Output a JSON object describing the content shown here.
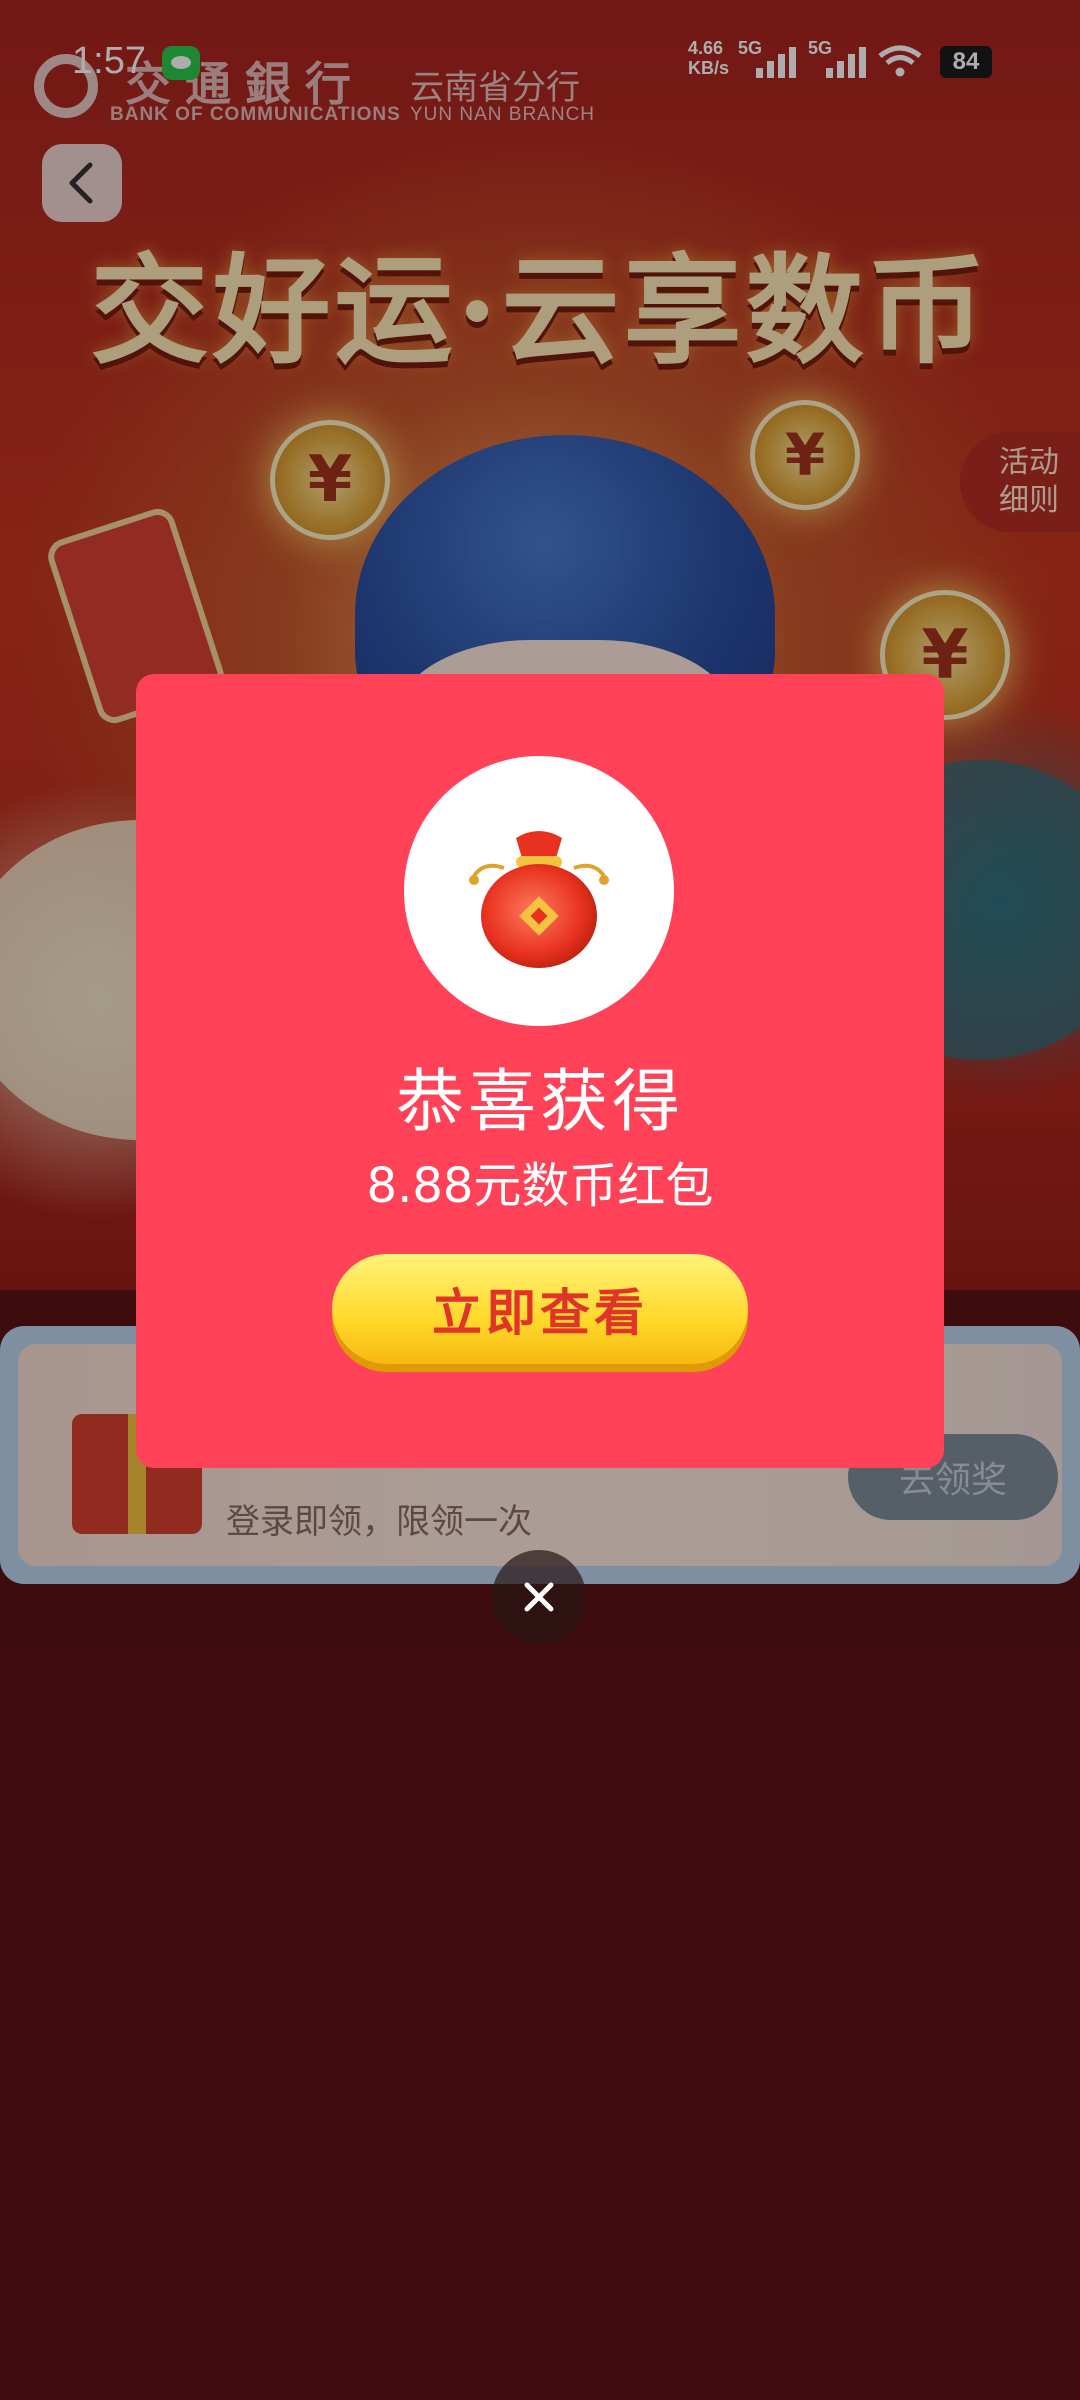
{
  "status_bar": {
    "time": "1:57",
    "net_speed_value": "4.66",
    "net_speed_unit": "KB/s",
    "network_type_1": "5G",
    "network_type_2": "5G",
    "battery": "84"
  },
  "header": {
    "bank_name_cn": "交通銀行",
    "bank_name_en": "BANK OF COMMUNICATIONS",
    "branch_cn": "云南省分行",
    "branch_en": "YUN NAN BRANCH"
  },
  "banner": {
    "title": "交好运·云享数币",
    "coin_symbol": "¥"
  },
  "rules_tab": {
    "line1": "活动",
    "line2": "细则"
  },
  "task_card": {
    "description": "登录即领，限领一次",
    "button_label": "去领奖"
  },
  "modal": {
    "title": "恭喜获得",
    "amount_text": "8.88元数币红包",
    "button_label": "立即查看"
  },
  "colors": {
    "modal_bg": "#ff4257",
    "button_yellow": "#ffd92a",
    "button_text": "#e0342a",
    "page_bg": "#5e1214"
  },
  "icons": {
    "back": "chevron-left-icon",
    "close": "close-icon",
    "prize": "lucky-bag-icon",
    "wifi": "wifi-icon",
    "message": "message-icon"
  }
}
